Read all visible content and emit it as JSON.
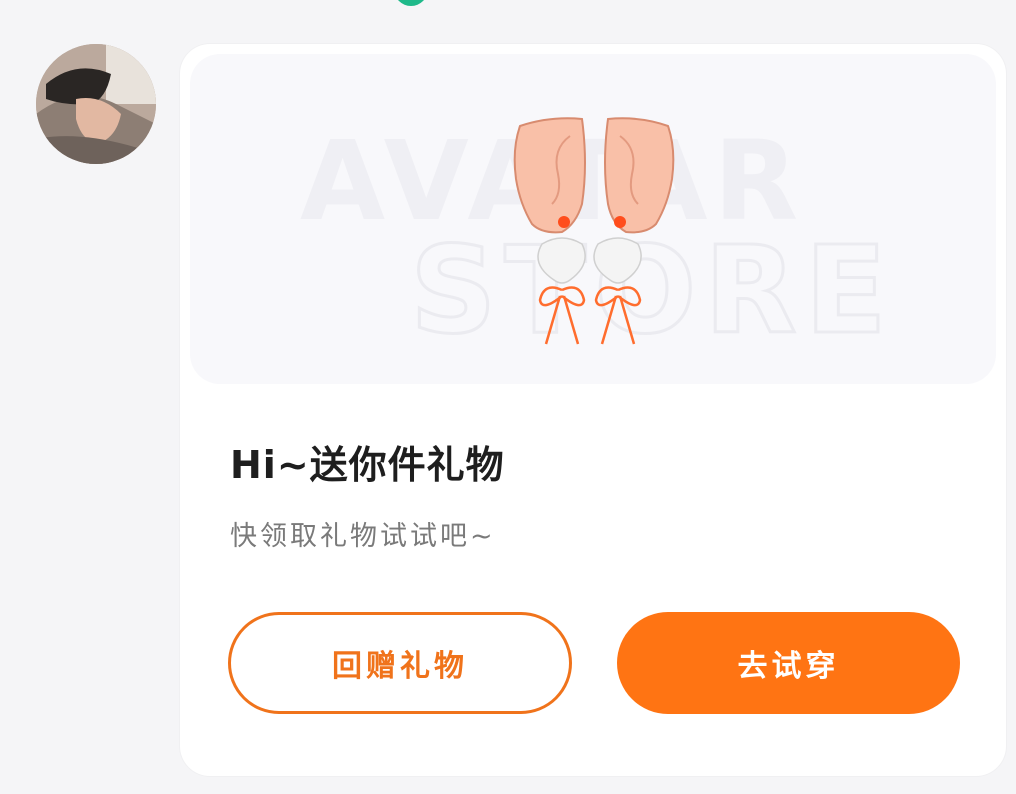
{
  "banner": {
    "watermark_line1": "AVATAR",
    "watermark_line2": "STORE"
  },
  "gift": {
    "title": "Hi~送你件礼物",
    "subtitle": "快领取礼物试试吧~"
  },
  "actions": {
    "return_gift_label": "回赠礼物",
    "try_on_label": "去试穿"
  },
  "colors": {
    "accent": "#ff7413",
    "status_dot": "#1fb98a"
  },
  "icons": {
    "gift_item": "ear-earrings-icon"
  }
}
